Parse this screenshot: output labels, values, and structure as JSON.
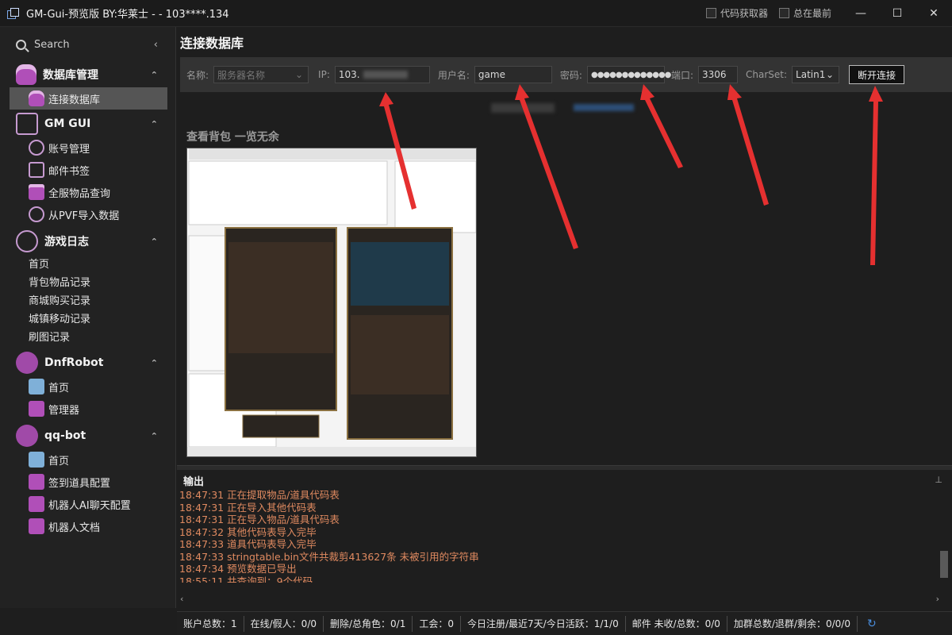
{
  "window": {
    "title": "GM-Gui-预览版 BY:华莱士 -  - 103****.134",
    "check_code_fetcher": "代码获取器",
    "check_on_top": "总在最前",
    "minimize": "—",
    "maximize": "☐",
    "close": "✕"
  },
  "sidebar": {
    "search": "Search",
    "groups": [
      {
        "label": "数据库管理",
        "items": [
          "连接数据库"
        ]
      },
      {
        "label": "GM GUI",
        "items": [
          "账号管理",
          "邮件书签",
          "全服物品查询",
          "从PVF导入数据"
        ]
      },
      {
        "label": "游戏日志",
        "items": [
          "首页",
          "背包物品记录",
          "商城购买记录",
          "城镇移动记录",
          "刷图记录"
        ]
      },
      {
        "label": "DnfRobot",
        "items": [
          "首页",
          "管理器"
        ]
      },
      {
        "label": "qq-bot",
        "items": [
          "首页",
          "签到道具配置",
          "机器人AI聊天配置",
          "机器人文档"
        ]
      }
    ]
  },
  "main": {
    "title": "连接数据库",
    "conn": {
      "name_label": "名称:",
      "name_placeholder": "服务器名称",
      "ip_label": "IP:",
      "ip_value": "103.",
      "user_label": "用户名:",
      "user_value": "game",
      "pwd_label": "密码:",
      "pwd_value": "●●●●●●●●●●●●●",
      "port_label": "端口:",
      "port_value": "3306",
      "charset_label": "CharSet:",
      "charset_value": "Latin1",
      "disconnect": "断开连接"
    },
    "preview_title": "查看背包 一览无余",
    "output_title": "输出",
    "logs": [
      "18:47:31 正在提取物品/道具代码表",
      "18:47:31 正在导入其他代码表",
      "18:47:31 正在导入物品/道具代码表",
      "18:47:32 其他代码表导入完毕",
      "18:47:33 道具代码表导入完毕",
      "18:47:33 stringtable.bin文件共裁剪413627条 未被引用的字符串",
      "18:47:34 预览数据已导出",
      "18:55:11 共查询到：9个代码"
    ]
  },
  "status": [
    "账户总数：1",
    "在线/假人：0/0",
    "删除/总角色：0/1",
    "工会：0",
    "今日注册/最近7天/今日活跃：1/1/0",
    "邮件 未收/总数：0/0",
    "加群总数/退群/剩余：0/0/0"
  ],
  "colors": {
    "accent": "#e03030",
    "log": "#e08a60",
    "group_icon": "#b04fb8"
  }
}
